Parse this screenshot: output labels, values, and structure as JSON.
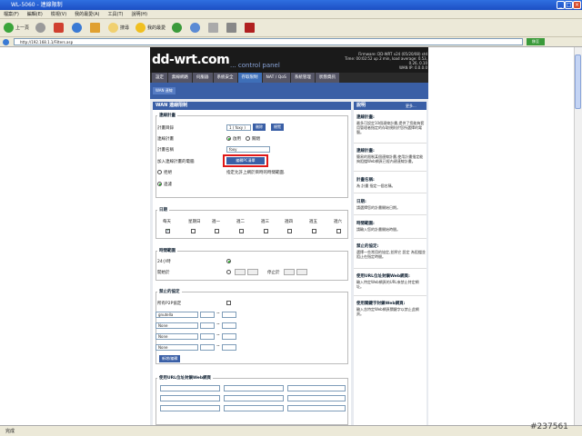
{
  "window": {
    "title": "WL-5060 - 連線限制"
  },
  "menu": [
    "檔案(F)",
    "編輯(E)",
    "檢視(V)",
    "我的最愛(A)",
    "工具(T)",
    "說明(H)"
  ],
  "toolbar": {
    "back": "上一頁",
    "search": "搜尋",
    "favorites": "我的最愛"
  },
  "address": {
    "url": "http://192.168.1.1/Filters.asp",
    "go": "移至"
  },
  "router": {
    "logo": "dd-wrt.com",
    "logo_sub": "... control panel",
    "firmware": "Firmware: DD-WRT v24 (05/20/08) std",
    "time": "Time: 00:02:52 up 2 min, load average: 0.53, 0.26, 0.10",
    "wan_ip": "WAN IP: 0.0.0.0"
  },
  "tabs": [
    "設定",
    "無線網路",
    "伺服器",
    "系統安全",
    "存取限制",
    "NAT / QoS",
    "系統管理",
    "狀態資訊"
  ],
  "subtab": "WAN 連線",
  "page_title": "WAN 連線限制",
  "policy": {
    "legend": "連線計畫",
    "policy_label": "計畫目錄",
    "policy_value": "1 ( foxy )",
    "delete_btn": "刪除",
    "summary_btn": "總覽",
    "status_label": "連線計畫",
    "enable": "啟用",
    "disable": "關閉",
    "name_label": "計畫名稱",
    "name_value": "foxy",
    "pcs_label": "加入連線計畫的電腦",
    "edit_btn": "編輯PC清單",
    "deny": "拒絕",
    "filter": "過濾",
    "note": "指定允許上網於目時的時間範圍."
  },
  "days": {
    "legend": "日期",
    "labels": [
      "每天",
      "星期日",
      "週一",
      "週二",
      "週三",
      "週四",
      "週五",
      "週六"
    ]
  },
  "times": {
    "legend": "時間範圍",
    "allday": "24小時",
    "from": "開始於",
    "to": "停止於"
  },
  "services": {
    "legend": "禁止的協定",
    "catchall": "所有P2P協定",
    "rows": [
      "gnutella",
      "None",
      "None",
      "None"
    ],
    "add_btn": "新增/編輯",
    "tilde": "~"
  },
  "urls": {
    "legend": "使用URL位址封鎖Web網頁"
  },
  "sidebar": {
    "title": "說明",
    "more": "更多...",
    "items": [
      {
        "h": "連線計畫:",
        "t": "最多可設定10個連線計畫,提供了您能夠套用管理者指定的存取規則於您所選擇的電腦。"
      },
      {
        "h": "連線計畫:",
        "t": "簡易的限制某個連線計畫,使用計畫指定能夠阻擋Web網頁已經內建連線計畫。"
      },
      {
        "h": "計畫名稱:",
        "t": "為 計畫 指定一個名稱。"
      },
      {
        "h": "日期:",
        "t": "請選擇您的計畫開始日期。"
      },
      {
        "h": "時間範圍:",
        "t": "請輸入您的計畫開始時間。"
      },
      {
        "h": "禁止的協定:",
        "t": "選擇一些常用的協定,並將它 設定 為阻擋並阻止在指定時間。"
      },
      {
        "h": "使用URL位址封鎖Web網頁:",
        "t": "輸入特定Web網頁的URL來禁止特定網址。"
      },
      {
        "h": "使用關鍵字封鎖Web網頁:",
        "t": "輸入含特定Web網頁關鍵字以禁止此網頁。"
      }
    ]
  },
  "status": "完成",
  "watermark": "#237561"
}
